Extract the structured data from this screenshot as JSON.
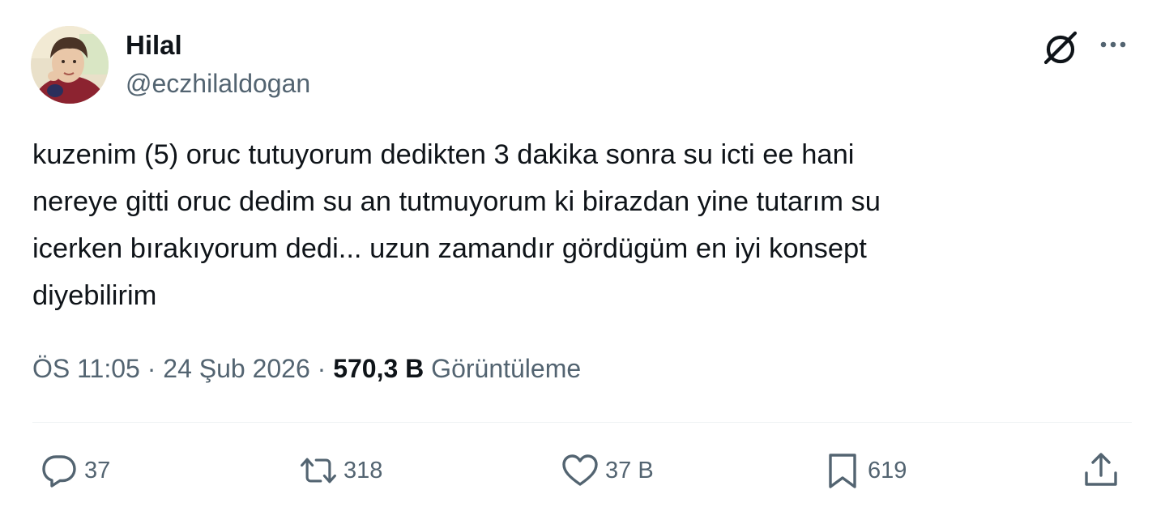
{
  "author": {
    "display_name": "Hilal",
    "handle": "@eczhilaldogan"
  },
  "tweet": {
    "text": "kuzenim (5) oruc tutuyorum dedikten 3 dakika sonra su icti ee hani\nnereye gitti oruc dedim su an tutmuyorum ki birazdan yine tutarım su\nicerken bırakıyorum dedi... uzun zamandır gördügüm en iyi konsept\ndiyebilirim"
  },
  "meta": {
    "time": "ÖS 11:05",
    "separator": "·",
    "date": "24 Şub 2026",
    "views_count": "570,3 B",
    "views_label": "Görüntüleme"
  },
  "actions": {
    "replies": "37",
    "retweets": "318",
    "likes": "37 B",
    "bookmarks": "619"
  },
  "icons": {
    "grok": "grok-icon",
    "more": "more-options-icon",
    "reply": "reply-icon",
    "retweet": "retweet-icon",
    "like": "heart-icon",
    "bookmark": "bookmark-icon",
    "share": "share-icon"
  },
  "colors": {
    "text_primary": "#0f1419",
    "text_secondary": "#536471",
    "divider": "#eff3f4"
  }
}
